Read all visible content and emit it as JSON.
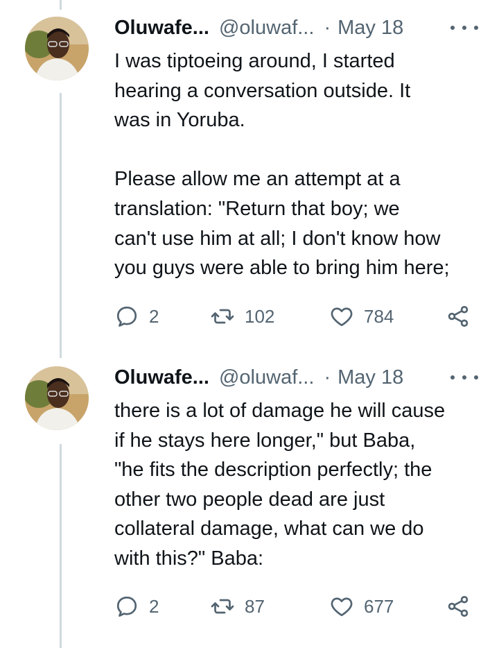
{
  "tweets": [
    {
      "author": {
        "name": "Oluwafe...",
        "handle": "@oluwaf...",
        "avatar_icon": "profile-photo"
      },
      "separator": "·",
      "time": "May 18",
      "text": "I was tiptoeing around, I started\nhearing a conversation outside. It\nwas in Yoruba.\n\nPlease allow me an attempt at a\ntranslation: \"Return that boy; we\ncan't use him at all; I don't know how\nyou guys were able to bring him here;",
      "actions": {
        "replies": "2",
        "retweets": "102",
        "likes": "784"
      }
    },
    {
      "author": {
        "name": "Oluwafe...",
        "handle": "@oluwaf...",
        "avatar_icon": "profile-photo"
      },
      "separator": "·",
      "time": "May 18",
      "text": "there is a lot of damage he will cause\nif he stays here longer,\" but Baba,\n\"he fits the description perfectly; the\nother two people dead are just\ncollateral damage, what can we do\nwith this?\" Baba:",
      "actions": {
        "replies": "2",
        "retweets": "87",
        "likes": "677"
      }
    }
  ],
  "colors": {
    "text": "#0f1419",
    "secondary": "#536471",
    "thread_line": "#cfd9de"
  }
}
